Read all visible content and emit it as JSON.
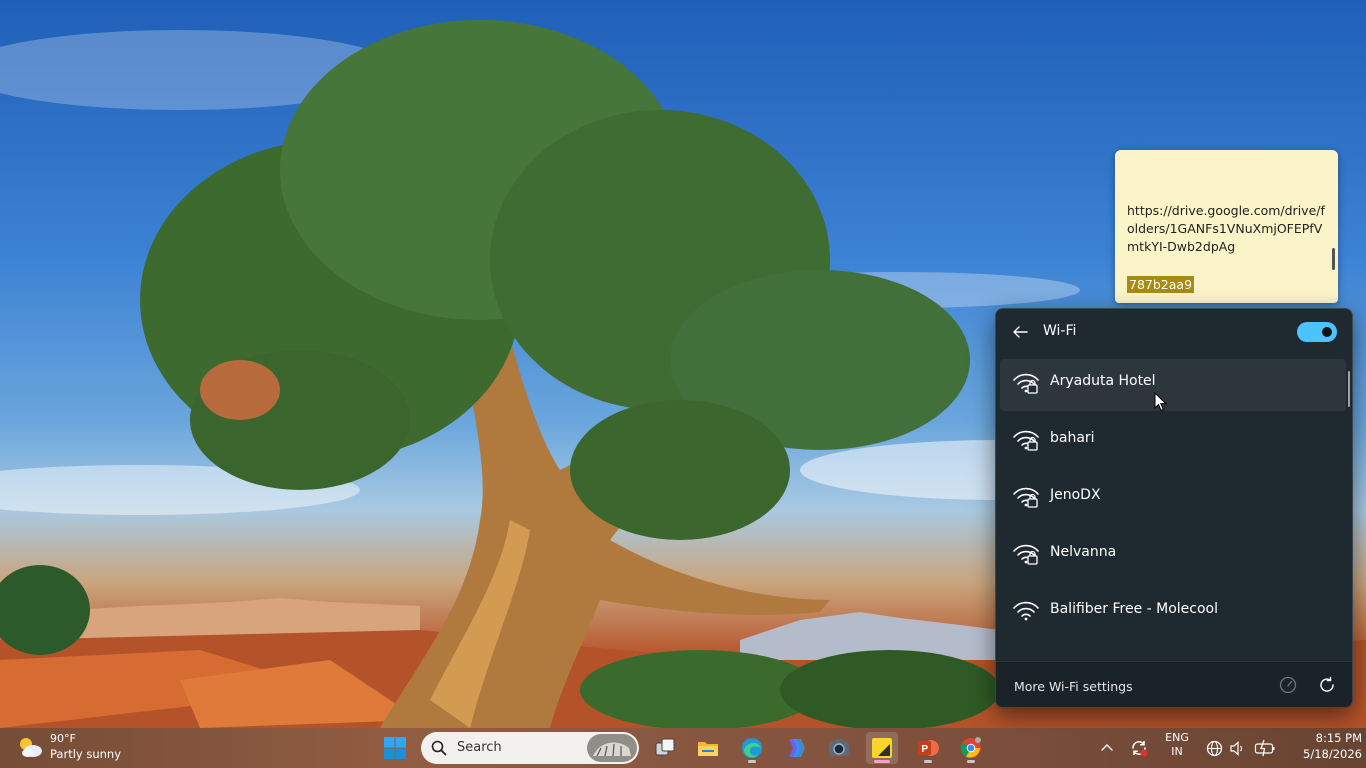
{
  "sticky_note": {
    "link": "https://drive.google.com/drive/folders/1GANFs1VNuXmjOFEPfVmtkYI-Dwb2dpAg",
    "highlighted": "787b2aa9"
  },
  "wifi": {
    "title": "Wi-Fi",
    "enabled": true,
    "networks": [
      {
        "name": "Aryaduta Hotel",
        "secured": true
      },
      {
        "name": "bahari",
        "secured": true
      },
      {
        "name": "JenoDX",
        "secured": true
      },
      {
        "name": "Nelvanna",
        "secured": true
      },
      {
        "name": "Balifiber Free - Molecool",
        "secured": false
      }
    ],
    "more_settings": "More Wi-Fi settings"
  },
  "taskbar": {
    "weather": {
      "temp": "90°F",
      "condition": "Partly sunny"
    },
    "search_placeholder": "Search",
    "language": {
      "line1": "ENG",
      "line2": "IN"
    },
    "time": "8:15 PM",
    "date": "5/18/2026"
  },
  "colors": {
    "accent": "#4cc2ff",
    "flyout_bg": "#1f2a30",
    "sticky_bg": "#fbf4c9",
    "highlight": "#a88b10"
  }
}
